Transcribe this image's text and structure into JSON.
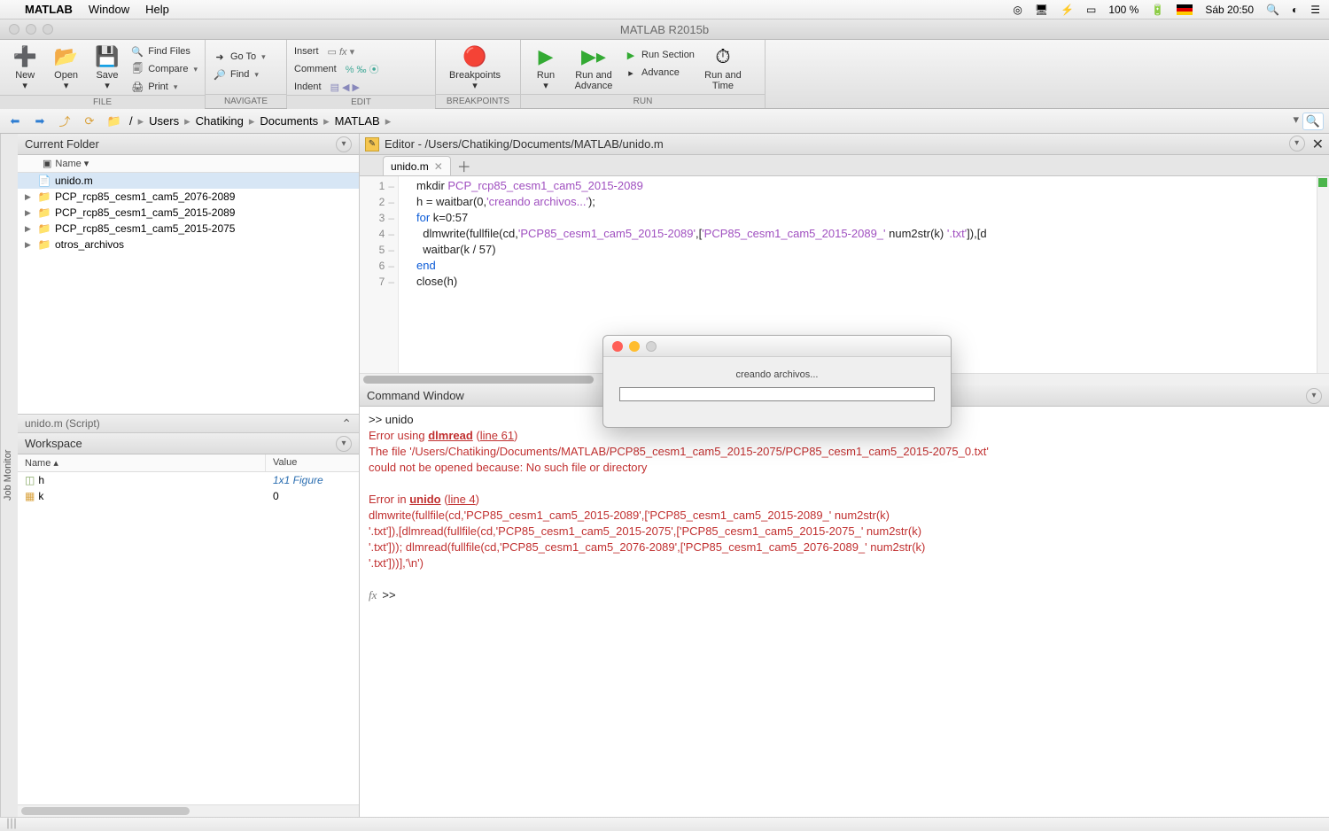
{
  "menubar": {
    "apple": "",
    "app_name": "MATLAB",
    "items": [
      "Window",
      "Help"
    ],
    "battery": "100 %",
    "clock": "Sáb 20:50"
  },
  "window_title": "MATLAB R2015b",
  "toolstrip": {
    "file": {
      "label": "FILE",
      "new": "New",
      "open": "Open",
      "save": "Save",
      "find_files": "Find Files",
      "compare": "Compare",
      "print": "Print"
    },
    "navigate": {
      "label": "NAVIGATE",
      "goto": "Go To",
      "find": "Find"
    },
    "edit": {
      "label": "EDIT",
      "insert": "Insert",
      "comment": "Comment",
      "indent": "Indent"
    },
    "breakpoints": {
      "label": "BREAKPOINTS",
      "breakpoints": "Breakpoints"
    },
    "run": {
      "label": "RUN",
      "run": "Run",
      "run_advance": "Run and\nAdvance",
      "run_section": "Run Section",
      "advance": "Advance",
      "run_time": "Run and\nTime"
    }
  },
  "breadcrumb": [
    "/",
    "Users",
    "Chatiking",
    "Documents",
    "MATLAB"
  ],
  "current_folder": {
    "title": "Current Folder",
    "name_header": "Name ▾",
    "items": [
      {
        "name": "unido.m",
        "type": "file",
        "selected": true
      },
      {
        "name": "PCP_rcp85_cesm1_cam5_2076-2089",
        "type": "folder"
      },
      {
        "name": "PCP_rcp85_cesm1_cam5_2015-2089",
        "type": "folder"
      },
      {
        "name": "PCP_rcp85_cesm1_cam5_2015-2075",
        "type": "folder"
      },
      {
        "name": "otros_archivos",
        "type": "folder"
      }
    ],
    "status": "unido.m  (Script)"
  },
  "workspace": {
    "title": "Workspace",
    "name_header": "Name ▴",
    "value_header": "Value",
    "rows": [
      {
        "name": "h",
        "value": "1x1 Figure",
        "figure": true
      },
      {
        "name": "k",
        "value": "0",
        "figure": false
      }
    ]
  },
  "editor": {
    "title": "Editor - /Users/Chatiking/Documents/MATLAB/unido.m",
    "tab": "unido.m",
    "lines": [
      {
        "n": "1",
        "html": "mkdir <span class='pp'>PCP_rcp85_cesm1_cam5_2015-2089</span>"
      },
      {
        "n": "2",
        "html": "h = waitbar(0,<span class='str'>'creando archivos...'</span>);"
      },
      {
        "n": "3",
        "html": "<span class='kw'>for</span> k=0:57"
      },
      {
        "n": "4",
        "html": "  dlmwrite(fullfile(cd,<span class='str'>'PCP85_cesm1_cam5_2015-2089'</span>,[<span class='str'>'PCP85_cesm1_cam5_2015-2089_'</span> num2str(k) <span class='str'>'.txt'</span>]),[d"
      },
      {
        "n": "5",
        "html": "  waitbar(k / 57)"
      },
      {
        "n": "6",
        "html": "<span class='kw'>end</span>"
      },
      {
        "n": "7",
        "html": "close(h)"
      }
    ]
  },
  "command_window": {
    "title": "Command Window",
    "content_html": "&gt;&gt; unido<br><span class='err'>Error using <b class='uline'>dlmread</b> (<span class='uline'>line 61</span>)<br>The file '/Users/Chatiking/Documents/MATLAB/PCP85_cesm1_cam5_2015-2075/PCP85_cesm1_cam5_2015-2075_0.txt'<br>could not be opened because: No such file or directory<br><br>Error in <b class='uline'>unido</b> (<span class='uline'>line 4</span>)<br>dlmwrite(fullfile(cd,'PCP85_cesm1_cam5_2015-2089',['PCP85_cesm1_cam5_2015-2089_' num2str(k)<br>'.txt']),[dlmread(fullfile(cd,'PCP85_cesm1_cam5_2015-2075',['PCP85_cesm1_cam5_2015-2075_' num2str(k)<br>'.txt'])); dlmread(fullfile(cd,'PCP85_cesm1_cam5_2076-2089',['PCP85_cesm1_cam5_2076-2089_' num2str(k)<br>'.txt']))],'\\n')</span>",
    "prompt": ">>"
  },
  "waitbar": {
    "text": "creando archivos..."
  },
  "sidebar_label": "Job Monitor"
}
